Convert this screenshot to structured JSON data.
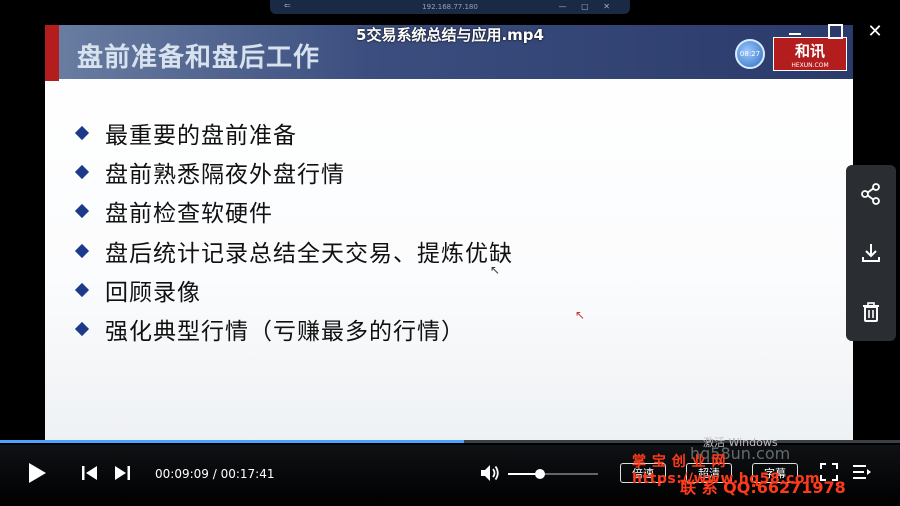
{
  "top_strip": {
    "address": "192.168.77.180"
  },
  "window": {
    "title": "5交易系统总结与应用.mp4"
  },
  "slide": {
    "title": "盘前准备和盘后工作",
    "clock_text": "08:27",
    "logo_text": "和讯",
    "logo_sub": "HEXUN.COM",
    "bullets": [
      "最重要的盘前准备",
      "盘前熟悉隔夜外盘行情",
      "盘前检查软硬件",
      "盘后统计记录总结全天交易、提炼优缺",
      "回顾录像",
      "强化典型行情（亏赚最多的行情）"
    ]
  },
  "watermarks": {
    "activate_windows": "激活 Windows",
    "site": "hq58un.com"
  },
  "player": {
    "progress": 0.516,
    "current_time": "00:09:09",
    "duration": "00:17:41",
    "time_display": "00:09:09 / 00:17:41",
    "volume": 0.35,
    "speed_label": "倍速",
    "quality_label": "超清",
    "subtitle_label": "字幕"
  },
  "overlay": {
    "line1": "掌 宝 创 业 网 https://www.hq58.com",
    "line2": "联 系 QQ:66271978"
  },
  "icons": {
    "side": [
      "share-icon",
      "download-icon",
      "trash-icon"
    ],
    "controls": [
      "play-icon",
      "previous-icon",
      "next-icon",
      "volume-icon",
      "fullscreen-icon",
      "playlist-icon"
    ]
  },
  "colors": {
    "progress": "#4aa3ff",
    "header": "#2a3a6a",
    "accent_red": "#b31d1d",
    "overlay_red": "#ff3a1a"
  }
}
